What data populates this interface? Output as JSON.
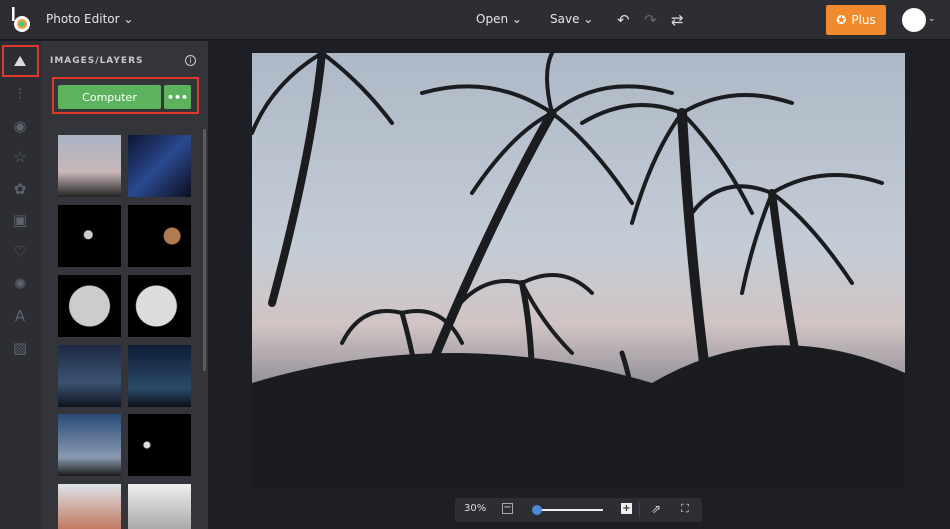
{
  "header": {
    "app_title": "Photo Editor",
    "open_label": "Open",
    "save_label": "Save",
    "plus_label": "Plus"
  },
  "panel": {
    "title": "IMAGES/LAYERS",
    "computer_label": "Computer",
    "more_label": "•••"
  },
  "sidebar": {
    "items": [
      "image",
      "adjust",
      "eye",
      "star",
      "effects",
      "frame",
      "heart",
      "graphics",
      "text",
      "texture"
    ]
  },
  "zoom": {
    "level": "30%",
    "fraction": 0.05
  },
  "colors": {
    "accent": "#5cb25d",
    "plus": "#f08a2b",
    "highlight": "#e0392b"
  }
}
